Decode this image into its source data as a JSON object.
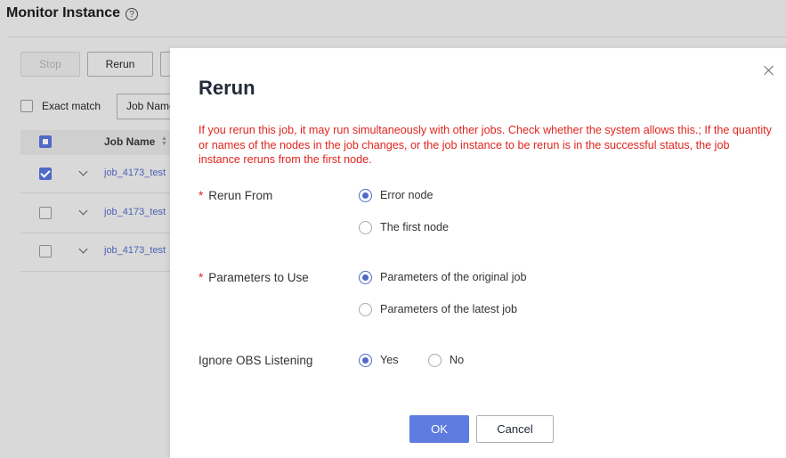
{
  "background": {
    "title": "Monitor Instance",
    "help_glyph": "?",
    "toolbar": {
      "stop_label": "Stop",
      "rerun_label": "Rerun"
    },
    "filter": {
      "exact_match_label": "Exact match",
      "select_value": "Job Name"
    },
    "table": {
      "column_job_name": "Job Name",
      "rows": [
        {
          "job": "job_4173_test",
          "checked": true
        },
        {
          "job": "job_4173_test",
          "checked": false
        },
        {
          "job": "job_4173_test",
          "checked": false
        }
      ]
    }
  },
  "dialog": {
    "title": "Rerun",
    "warning": "If you rerun this job, it may run simultaneously with other jobs. Check whether the system allows this.; If the quantity or names of the nodes in the job changes, or the job instance to be rerun is in the successful status, the job instance reruns from the first node.",
    "required_mark": "*",
    "rerun_from": {
      "label": "Rerun From",
      "options": [
        "Error node",
        "The first node"
      ],
      "selected": "Error node"
    },
    "parameters": {
      "label": "Parameters to Use",
      "options": [
        "Parameters of the original job",
        "Parameters of the latest job"
      ],
      "selected": "Parameters of the original job"
    },
    "ignore_obs": {
      "label": "Ignore OBS Listening",
      "options": [
        "Yes",
        "No"
      ],
      "selected": "Yes"
    },
    "ok_label": "OK",
    "cancel_label": "Cancel"
  },
  "colors": {
    "accent": "#5e7ce0",
    "warning": "#e0241e",
    "link": "#4b62b6"
  }
}
